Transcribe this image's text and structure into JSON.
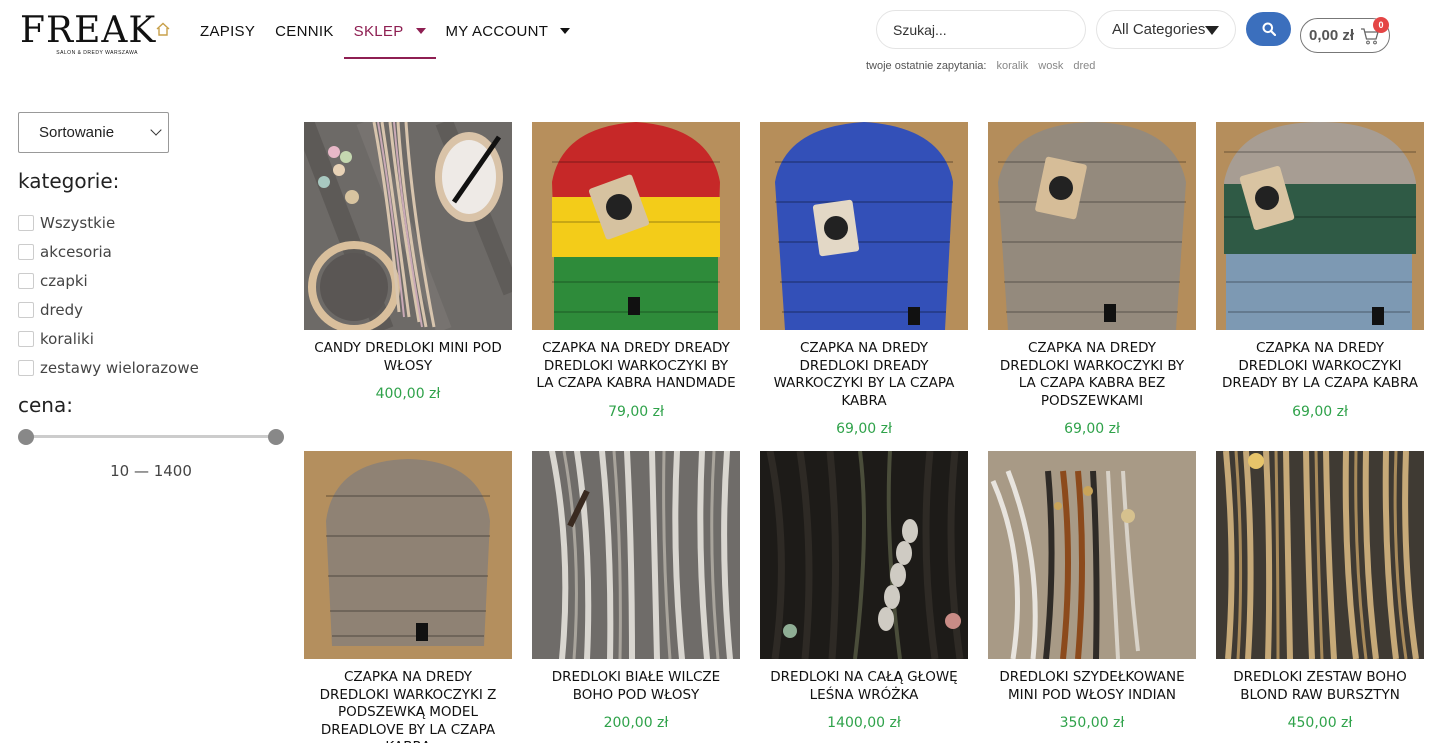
{
  "logo": {
    "text": "FREAK",
    "subtitle": "SALON & DREDY WARSZAWA"
  },
  "nav": {
    "home_icon": "home-icon",
    "items": [
      {
        "label": "ZAPISY"
      },
      {
        "label": "CENNIK"
      },
      {
        "label": "SKLEP"
      },
      {
        "label": "MY ACCOUNT"
      }
    ]
  },
  "search": {
    "placeholder": "Szukaj...",
    "category": "All Categories"
  },
  "cart": {
    "total": "0,00 zł",
    "count": "0"
  },
  "recent": {
    "label": "twoje ostatnie zapytania:",
    "terms": [
      "koralik",
      "wosk",
      "dred"
    ]
  },
  "sidebar": {
    "sort_label": "Sortowanie",
    "categories_heading": "kategorie:",
    "categories": [
      "Wszystkie",
      "akcesoria",
      "czapki",
      "dredy",
      "koraliki",
      "zestawy wielorazowe"
    ],
    "price_heading": "cena:",
    "price_range": "10 — 1400"
  },
  "products": [
    {
      "title": "CANDY DREDLOKI MINI POD WŁOSY",
      "price": "400,00 zł"
    },
    {
      "title": "CZAPKA NA DREDY DREADY DREDLOKI WARKOCZYKI BY LA CZAPA KABRA HANDMADE",
      "price": "79,00 zł"
    },
    {
      "title": "CZAPKA NA DREDY DREDLOKI DREADY WARKOCZYKI BY LA CZAPA KABRA",
      "price": "69,00 zł"
    },
    {
      "title": "CZAPKA NA DREDY DREDLOKI WARKOCZYKI BY LA CZAPA KABRA BEZ PODSZEWKAMI",
      "price": "69,00 zł"
    },
    {
      "title": "CZAPKA NA DREDY DREDLOKI WARKOCZYKI DREADY BY LA CZAPA KABRA",
      "price": "69,00 zł"
    },
    {
      "title": "CZAPKA NA DREDY DREDLOKI WARKOCZYKI Z PODSZEWKĄ MODEL DREADLOVE BY LA CZAPA KABRA",
      "price": ""
    },
    {
      "title": "DREDLOKI BIAŁE WILCZE BOHO POD WŁOSY",
      "price": "200,00 zł"
    },
    {
      "title": "DREDLOKI NA CAŁĄ GŁOWĘ LEŚNA WRÓŻKA",
      "price": "1400,00 zł"
    },
    {
      "title": "DREDLOKI SZYDEŁKOWANE MINI POD WŁOSY INDIAN",
      "price": "350,00 zł"
    },
    {
      "title": "DREDLOKI ZESTAW BOHO BLOND RAW BURSZTYN",
      "price": "450,00 zł"
    }
  ],
  "colors": {
    "accent": "#8e1f52",
    "price": "#2fa24a",
    "search_button": "#3b6fbd",
    "badge": "#e44545"
  }
}
